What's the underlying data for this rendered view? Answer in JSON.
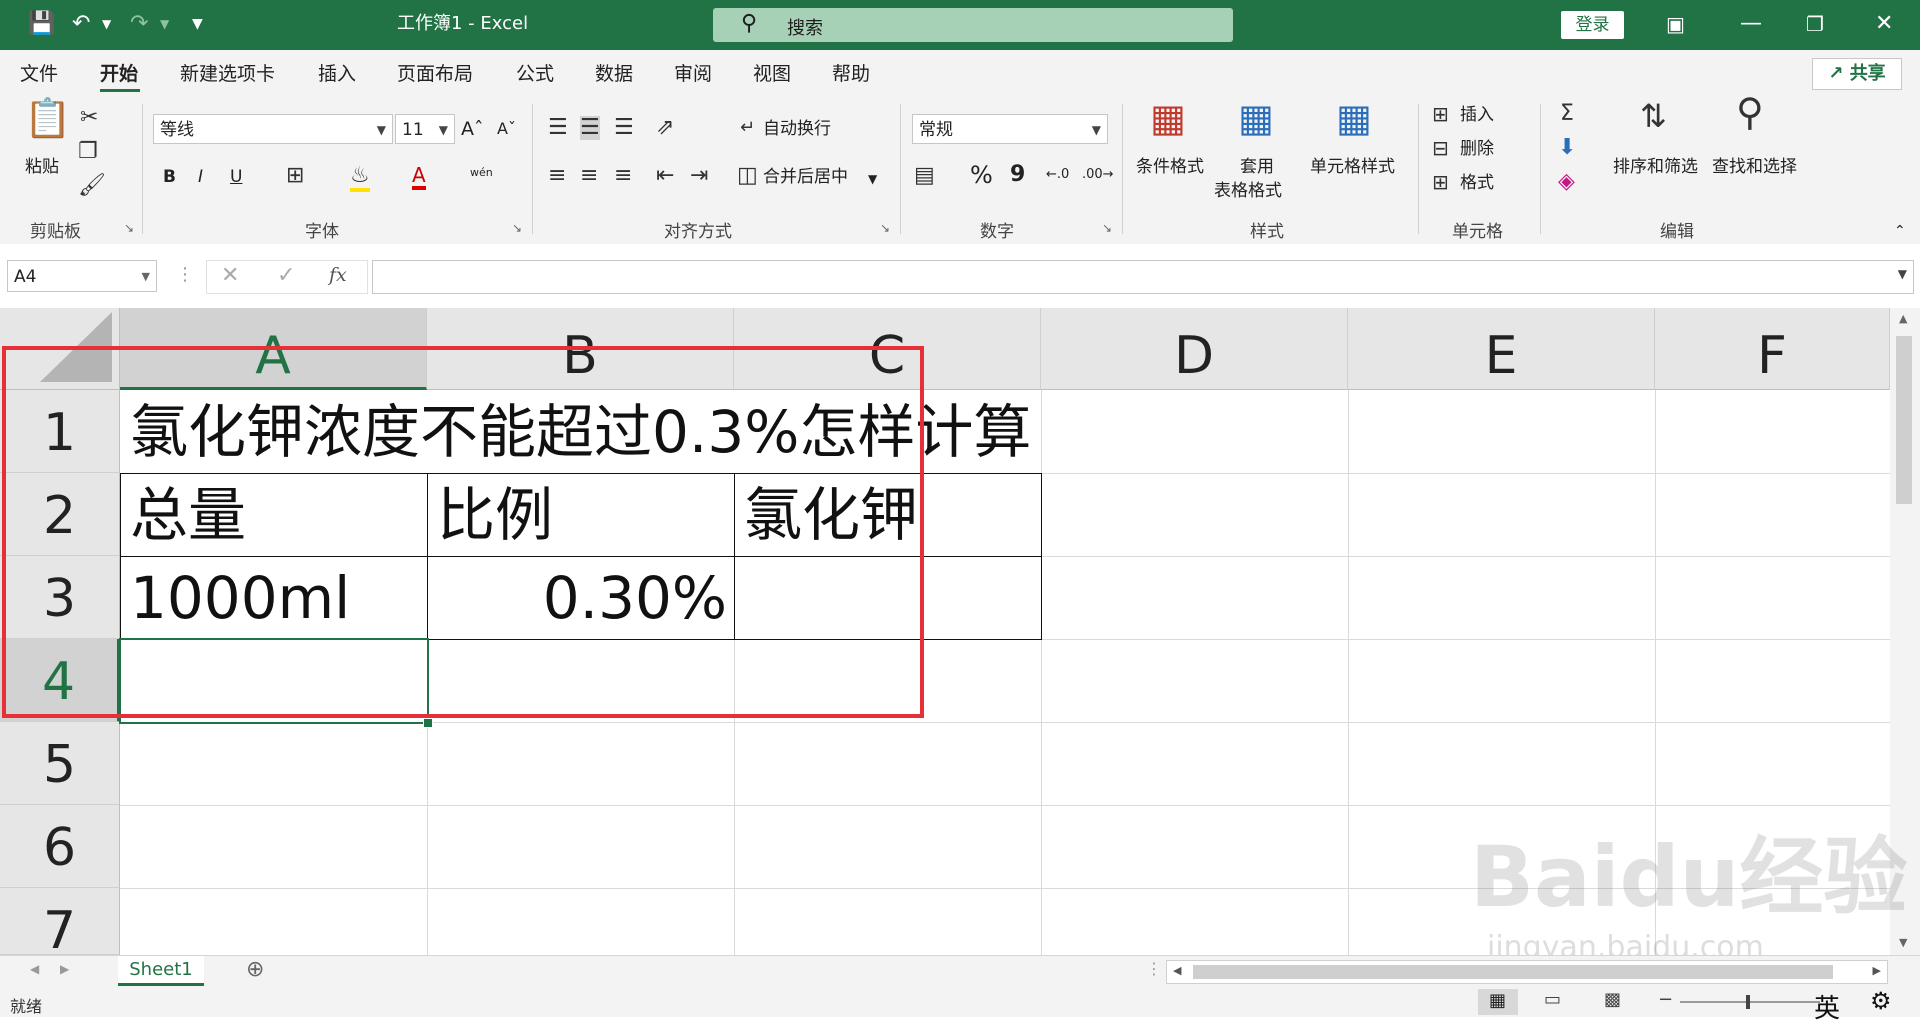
{
  "titlebar": {
    "window_title": "工作簿1  -  Excel",
    "search_label": "搜索",
    "login_label": "登录"
  },
  "tabs": [
    "文件",
    "开始",
    "新建选项卡",
    "插入",
    "页面布局",
    "公式",
    "数据",
    "审阅",
    "视图",
    "帮助"
  ],
  "share_label": "共享",
  "ribbon": {
    "paste_label": "粘贴",
    "clipboard_group": "剪贴板",
    "font_name": "等线",
    "font_size": "11",
    "font_group": "字体",
    "wrap_text": "自动换行",
    "merge_center": "合并后居中",
    "alignment_group": "对齐方式",
    "number_format": "常规",
    "number_group": "数字",
    "conditional_format": "条件格式",
    "table_format_line1": "套用",
    "table_format_line2": "表格格式",
    "cell_styles": "单元格样式",
    "styles_group": "样式",
    "insert": "插入",
    "delete": "删除",
    "format": "格式",
    "cells_group": "单元格",
    "sort_filter": "排序和筛选",
    "find_select": "查找和选择",
    "editing_group": "编辑",
    "bold": "B",
    "italic": "I",
    "underline": "U",
    "percent": "%",
    "comma": "9",
    "wen": "wén"
  },
  "formula_bar": {
    "name_box": "A4",
    "fx": "fx",
    "formula": ""
  },
  "columns": [
    "A",
    "B",
    "C",
    "D",
    "E",
    "F"
  ],
  "rows": [
    "1",
    "2",
    "3",
    "4",
    "5",
    "6",
    "7"
  ],
  "cells": {
    "A1": "氯化钾浓度不能超过0.3%怎样计算",
    "A2": "总量",
    "B2": "比例",
    "C2": "氯化钾",
    "A3": "1000ml",
    "B3": "0.30%"
  },
  "selected_cell": "A4",
  "sheet_tab": "Sheet1",
  "status": "就绪",
  "ime_indicator": "英",
  "watermark": {
    "main": "Baidu经验",
    "sub": "jingyan.baidu.com"
  },
  "colors": {
    "excel_green": "#217346",
    "highlight_red": "#e5303a"
  }
}
